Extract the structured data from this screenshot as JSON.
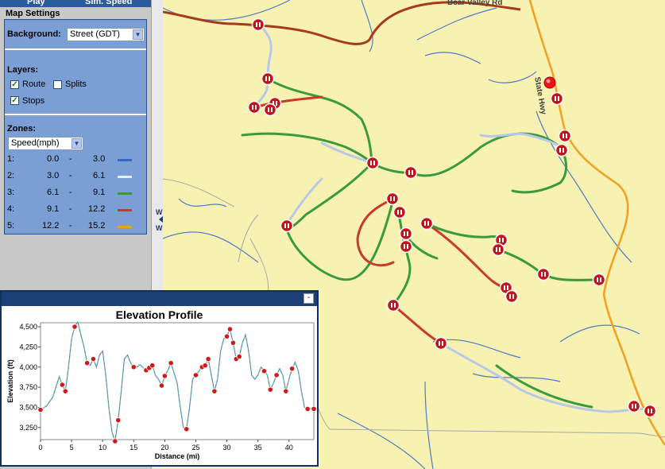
{
  "topbar": {
    "play_label": "Play",
    "speed_label": "Sim. Speed"
  },
  "settings": {
    "section_title": "Map Settings",
    "background_label": "Background:",
    "background_value": "Street (GDT)",
    "layers_label": "Layers:",
    "layers": [
      {
        "label": "Route",
        "checked": true
      },
      {
        "label": "Splits",
        "checked": false
      },
      {
        "label": "Stops",
        "checked": true
      }
    ],
    "zones_label": "Zones:",
    "zones_value": "Speed(mph)",
    "zones": [
      {
        "index": "1:",
        "from": "0.0",
        "dash": "-",
        "to": "3.0",
        "color": "#3a66c4"
      },
      {
        "index": "2:",
        "from": "3.0",
        "dash": "-",
        "to": "6.1",
        "color": "#e6eef8"
      },
      {
        "index": "3:",
        "from": "6.1",
        "dash": "-",
        "to": "9.1",
        "color": "#3b9a3b"
      },
      {
        "index": "4:",
        "from": "9.1",
        "dash": "-",
        "to": "12.2",
        "color": "#c83a2a"
      },
      {
        "index": "5:",
        "from": "12.2",
        "dash": "-",
        "to": "15.2",
        "color": "#f0a020"
      }
    ]
  },
  "divider": {
    "label_top": "W",
    "label_bottom": "W"
  },
  "map": {
    "road_bear_valley": "Bear Valley Rd",
    "road_state_hwy": "State Hwy"
  },
  "elevation_panel": {
    "minimize_label": "-",
    "title": "Elevation Profile",
    "chart_data": {
      "type": "line",
      "xlabel": "Distance (mi)",
      "ylabel": "Elevation (ft)",
      "xlim": [
        0,
        44
      ],
      "ylim": [
        3100,
        4550
      ],
      "xticks": [
        "0",
        "5",
        "10",
        "15",
        "20",
        "25",
        "30",
        "35",
        "40"
      ],
      "yticks": [
        "3,250",
        "3,500",
        "3,750",
        "4,000",
        "4,250",
        "4,500"
      ],
      "series": [
        {
          "x": [
            0,
            1,
            2,
            3,
            3.5,
            4,
            4.5,
            5,
            5.5,
            6,
            6.5,
            7,
            7.5,
            8,
            8.5,
            9,
            9.5,
            10,
            10.5,
            11,
            11.5,
            12,
            12.5,
            13,
            13.5,
            14,
            14.5,
            15,
            15.5,
            16,
            17,
            18,
            18.5,
            19,
            19.5,
            20,
            20.5,
            21,
            22,
            22.5,
            23,
            23.5,
            24,
            24.5,
            25,
            25.5,
            26,
            26.5,
            27,
            27.5,
            28,
            28.5,
            29,
            29.5,
            30,
            30.5,
            31,
            31.5,
            32,
            32.5,
            33,
            33.5,
            34,
            34.5,
            35,
            35.5,
            36,
            36.5,
            37,
            37.5,
            38,
            38.5,
            39,
            39.5,
            40,
            40.5,
            41,
            41.5,
            42,
            42.5,
            43,
            43.5,
            44
          ],
          "y": [
            3470,
            3520,
            3630,
            3880,
            3780,
            3700,
            4000,
            4350,
            4500,
            4560,
            4400,
            4250,
            4050,
            4020,
            4100,
            4000,
            4150,
            4200,
            3900,
            3500,
            3200,
            3080,
            3340,
            3700,
            4100,
            4150,
            4050,
            4000,
            4000,
            4030,
            3960,
            4020,
            3900,
            3850,
            3770,
            3890,
            3960,
            4050,
            3800,
            3500,
            3250,
            3230,
            3500,
            3850,
            3900,
            3950,
            4000,
            4020,
            4100,
            3900,
            3700,
            3850,
            4200,
            4350,
            4380,
            4470,
            4300,
            4100,
            4130,
            4300,
            4400,
            4200,
            3900,
            3850,
            3900,
            4000,
            3950,
            3900,
            3720,
            3800,
            3900,
            3980,
            3900,
            3700,
            3850,
            3980,
            4060,
            3950,
            3700,
            3500,
            3480,
            3490,
            3480
          ]
        }
      ],
      "stop_markers_x": [
        0,
        3.5,
        4,
        5.5,
        7.5,
        8.5,
        12,
        12.5,
        15,
        17,
        17.5,
        18,
        19.5,
        20,
        21,
        23.5,
        25,
        26,
        26.5,
        27,
        28,
        30,
        30.5,
        31,
        31.5,
        32,
        36,
        37,
        38,
        39.5,
        40.5,
        43,
        44
      ]
    }
  }
}
